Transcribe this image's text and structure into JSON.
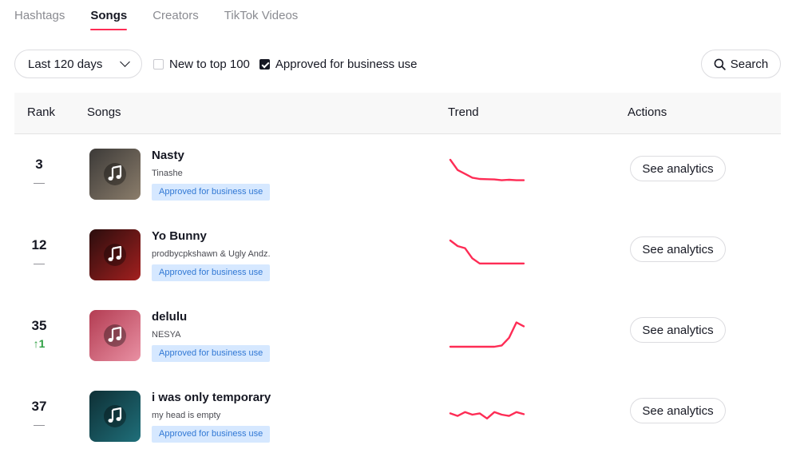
{
  "tabs": [
    {
      "label": "Hashtags",
      "active": false
    },
    {
      "label": "Songs",
      "active": true
    },
    {
      "label": "Creators",
      "active": false
    },
    {
      "label": "TikTok Videos",
      "active": false
    }
  ],
  "filters": {
    "period": "Last 120 days",
    "new_to_top": {
      "label": "New to top 100",
      "checked": false
    },
    "approved": {
      "label": "Approved for business use",
      "checked": true
    },
    "search_label": "Search"
  },
  "table": {
    "columns": [
      "Rank",
      "Songs",
      "Trend",
      "Actions"
    ],
    "trend_color": "#fe2c55",
    "rows": [
      {
        "rank": "3",
        "change": "—",
        "change_type": "none",
        "title": "Nasty",
        "artist": "Tinashe",
        "badge": "Approved for business use",
        "action": "See analytics",
        "cover_colors": [
          "#3c3a38",
          "#8b7d6b"
        ],
        "trend": [
          1.0,
          0.6,
          0.45,
          0.3,
          0.25,
          0.24,
          0.23,
          0.2,
          0.22,
          0.2,
          0.2
        ]
      },
      {
        "rank": "12",
        "change": "—",
        "change_type": "none",
        "title": "Yo Bunny",
        "artist": "prodbycpkshawn & Ugly Andz.",
        "badge": "Approved for business use",
        "action": "See analytics",
        "cover_colors": [
          "#2a0d0d",
          "#a3201f"
        ],
        "trend": [
          1.0,
          0.78,
          0.7,
          0.3,
          0.1,
          0.1,
          0.1,
          0.1,
          0.1,
          0.1,
          0.1
        ]
      },
      {
        "rank": "35",
        "change": "↑1",
        "change_type": "up",
        "title": "delulu",
        "artist": "NESYA",
        "badge": "Approved for business use",
        "action": "See analytics",
        "cover_colors": [
          "#b33c52",
          "#e990a3"
        ],
        "trend": [
          0.0,
          0.0,
          0.0,
          0.0,
          0.0,
          0.0,
          0.0,
          0.05,
          0.35,
          0.95,
          0.8
        ]
      },
      {
        "rank": "37",
        "change": "—",
        "change_type": "none",
        "title": "i was only temporary",
        "artist": "my head is empty",
        "badge": "Approved for business use",
        "action": "See analytics",
        "cover_colors": [
          "#0e2f35",
          "#1f6f7a"
        ],
        "trend": [
          0.55,
          0.45,
          0.6,
          0.5,
          0.55,
          0.35,
          0.6,
          0.5,
          0.45,
          0.6,
          0.52
        ]
      }
    ]
  },
  "icons": {
    "search": "search-icon",
    "chevron": "chevron-down-icon",
    "music": "music-note-icon"
  }
}
